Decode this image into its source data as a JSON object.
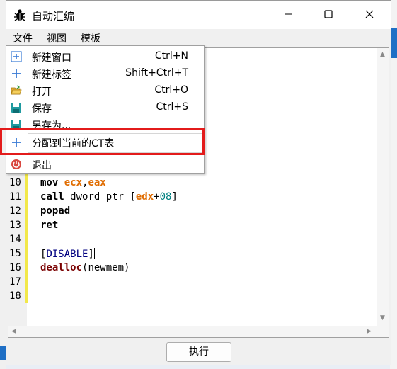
{
  "window": {
    "title": "自动汇编"
  },
  "menubar": {
    "items": [
      "文件",
      "视图",
      "模板"
    ]
  },
  "file_menu": {
    "items": [
      {
        "icon": "new-window-icon",
        "label": "新建窗口",
        "shortcut": "Ctrl+N"
      },
      {
        "icon": "plus-icon",
        "label": "新建标签",
        "shortcut": "Shift+Ctrl+T"
      },
      {
        "icon": "open-folder-icon",
        "label": "打开",
        "shortcut": "Ctrl+O"
      },
      {
        "icon": "save-icon",
        "label": "保存",
        "shortcut": "Ctrl+S"
      },
      {
        "icon": "save-as-icon",
        "label": "另存为...",
        "shortcut": ""
      },
      {
        "icon": "plus-icon",
        "label": "分配到当前的CT表",
        "shortcut": ""
      },
      {
        "icon": "power-icon",
        "label": "退出",
        "shortcut": ""
      }
    ]
  },
  "editor": {
    "line_numbers": [
      "10",
      "11",
      "12",
      "13",
      "14",
      "15",
      "16",
      "17",
      "18"
    ],
    "lines": [
      {
        "kw": "mov ",
        "a": "ecx",
        "sep": ",",
        "b": "eax"
      },
      {
        "kw": "call ",
        "text": "dword ptr [",
        "reg": "edx",
        "plus": "+",
        "num": "08",
        "close": "]"
      },
      {
        "kw": "popad"
      },
      {
        "kw": "ret"
      },
      {},
      {
        "open": "[",
        "sec": "DISABLE",
        "close": "]"
      },
      {
        "fn": "dealloc",
        "args": "(newmem)"
      },
      {},
      {}
    ]
  },
  "footer": {
    "run_label": "执行"
  },
  "colors": {
    "highlight": "#e31b1b",
    "register": "#e06c00",
    "number": "#008080",
    "section": "#000080"
  }
}
